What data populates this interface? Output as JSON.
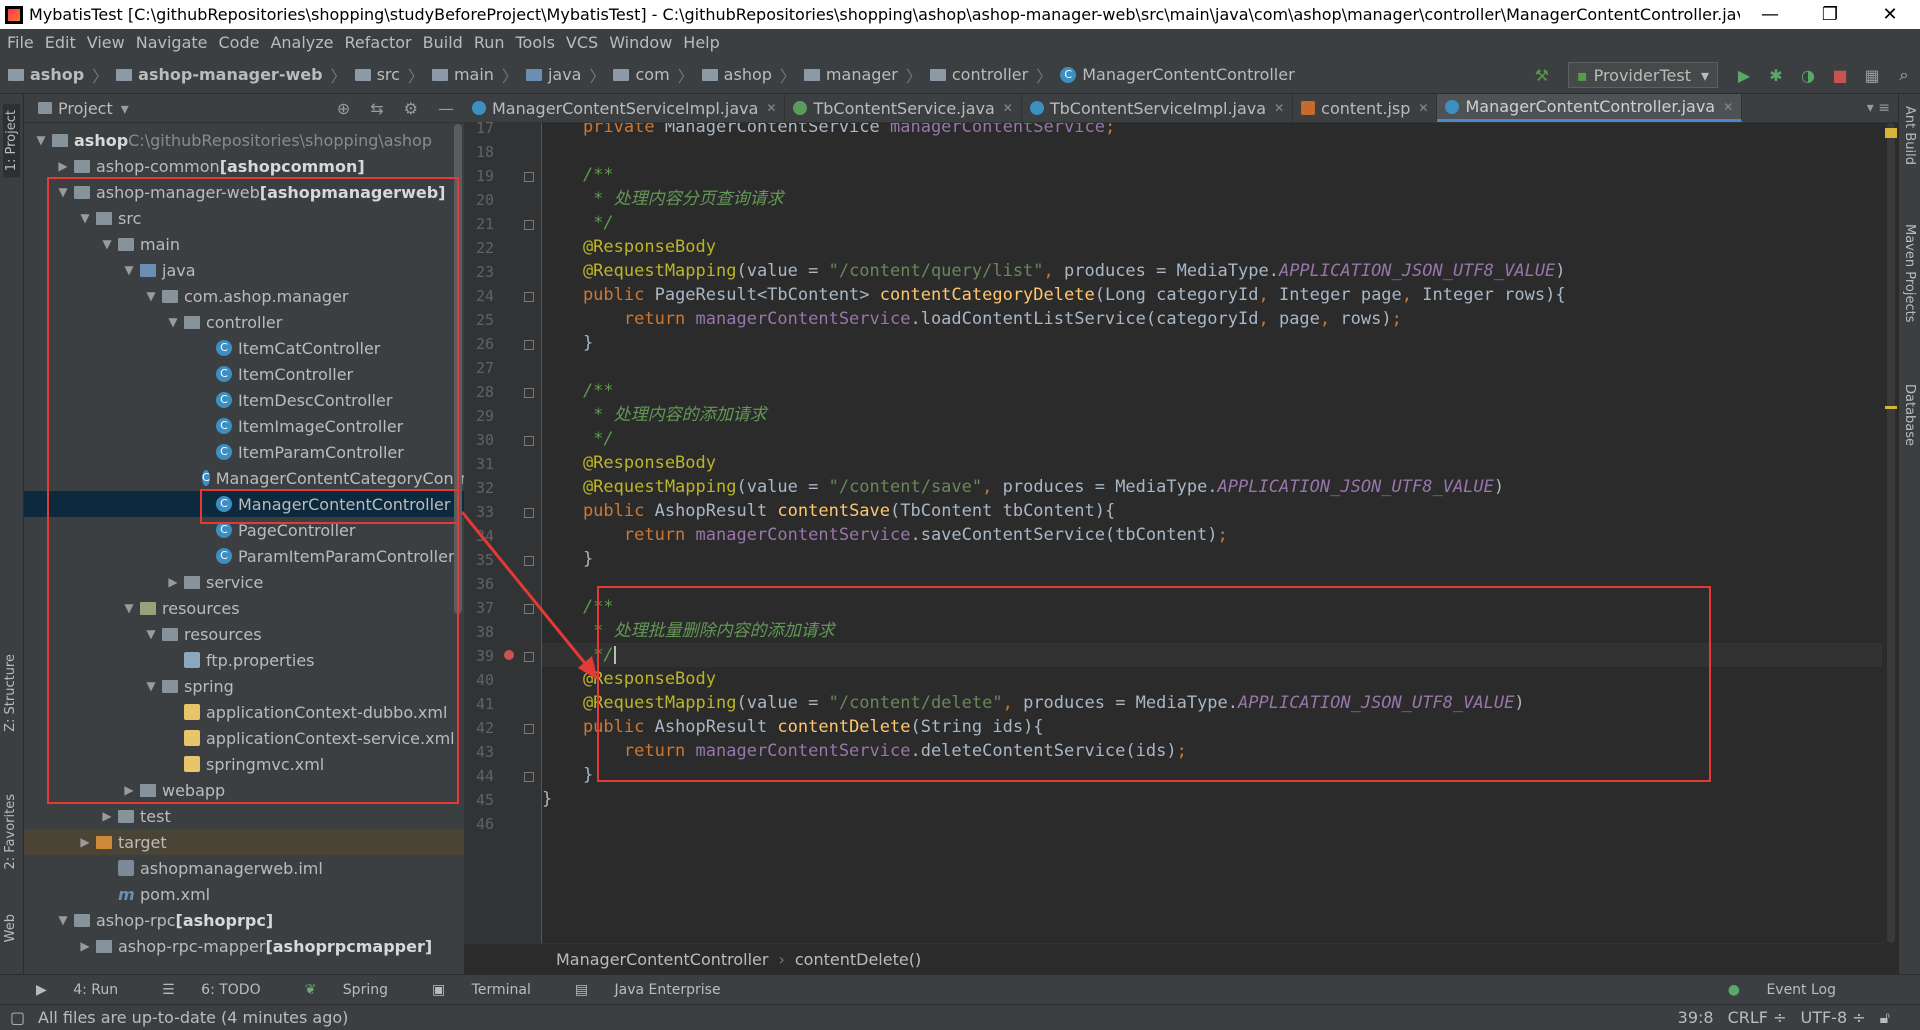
{
  "window": {
    "title": "MybatisTest [C:\\githubRepositories\\shopping\\studyBeforeProject\\MybatisTest] - C:\\githubRepositories\\shopping\\ashop\\ashop-manager-web\\src\\main\\java\\com\\ashop\\manager\\controller\\ManagerContentController.java [ashopmana...",
    "minimize": "—",
    "restore": "❐",
    "close": "✕"
  },
  "menu": [
    "File",
    "Edit",
    "View",
    "Navigate",
    "Code",
    "Analyze",
    "Refactor",
    "Build",
    "Run",
    "Tools",
    "VCS",
    "Window",
    "Help"
  ],
  "breadcrumbs": [
    "ashop",
    "ashop-manager-web",
    "src",
    "main",
    "java",
    "com",
    "ashop",
    "manager",
    "controller",
    "ManagerContentController"
  ],
  "run_config": "ProviderTest",
  "left_tabs": {
    "project": "1: Project",
    "structure": "Z: Structure",
    "favorites": "2: Favorites",
    "web": "Web"
  },
  "right_tabs": {
    "ant": "Ant Build",
    "maven": "Maven Projects",
    "database": "Database"
  },
  "project_panel": {
    "title": "Project",
    "dropdown": "▾"
  },
  "tree": [
    {
      "label": "ashop",
      "extra": "C:\\githubRepositories\\shopping\\ashop",
      "arrow": "▼",
      "icon": "folder-module"
    },
    {
      "label": "ashop-common",
      "extra": "[ashopcommon]",
      "arrow": "▶",
      "icon": "folder-module"
    },
    {
      "label": "ashop-manager-web",
      "extra": "[ashopmanagerweb]",
      "arrow": "▼",
      "icon": "folder-module"
    },
    {
      "label": "src",
      "extra": "",
      "arrow": "▼",
      "icon": "folder"
    },
    {
      "label": "main",
      "extra": "",
      "arrow": "▼",
      "icon": "folder"
    },
    {
      "label": "java",
      "extra": "",
      "arrow": "▼",
      "icon": "folder-source"
    },
    {
      "label": "com.ashop.manager",
      "extra": "",
      "arrow": "▼",
      "icon": "package"
    },
    {
      "label": "controller",
      "extra": "",
      "arrow": "▼",
      "icon": "package"
    },
    {
      "label": "ItemCatController",
      "extra": "",
      "arrow": "",
      "icon": "class"
    },
    {
      "label": "ItemController",
      "extra": "",
      "arrow": "",
      "icon": "class"
    },
    {
      "label": "ItemDescController",
      "extra": "",
      "arrow": "",
      "icon": "class"
    },
    {
      "label": "ItemImageController",
      "extra": "",
      "arrow": "",
      "icon": "class"
    },
    {
      "label": "ItemParamController",
      "extra": "",
      "arrow": "",
      "icon": "class"
    },
    {
      "label": "ManagerContentCategoryContr",
      "extra": "",
      "arrow": "",
      "icon": "class"
    },
    {
      "label": "ManagerContentController",
      "extra": "",
      "arrow": "",
      "icon": "class"
    },
    {
      "label": "PageController",
      "extra": "",
      "arrow": "",
      "icon": "class"
    },
    {
      "label": "ParamItemParamController",
      "extra": "",
      "arrow": "",
      "icon": "class"
    },
    {
      "label": "service",
      "extra": "",
      "arrow": "▶",
      "icon": "package"
    },
    {
      "label": "resources",
      "extra": "",
      "arrow": "▼",
      "icon": "folder-res"
    },
    {
      "label": "resources",
      "extra": "",
      "arrow": "▼",
      "icon": "package"
    },
    {
      "label": "ftp.properties",
      "extra": "",
      "arrow": "",
      "icon": "props"
    },
    {
      "label": "spring",
      "extra": "",
      "arrow": "▼",
      "icon": "package"
    },
    {
      "label": "applicationContext-dubbo.xml",
      "extra": "",
      "arrow": "",
      "icon": "xml"
    },
    {
      "label": "applicationContext-service.xml",
      "extra": "",
      "arrow": "",
      "icon": "xml"
    },
    {
      "label": "springmvc.xml",
      "extra": "",
      "arrow": "",
      "icon": "xml"
    },
    {
      "label": "webapp",
      "extra": "",
      "arrow": "▶",
      "icon": "folder"
    },
    {
      "label": "test",
      "extra": "",
      "arrow": "▶",
      "icon": "folder"
    },
    {
      "label": "target",
      "extra": "",
      "arrow": "▶",
      "icon": "folder-target"
    },
    {
      "label": "ashopmanagerweb.iml",
      "extra": "",
      "arrow": "",
      "icon": "iml"
    },
    {
      "label": "pom.xml",
      "extra": "",
      "arrow": "",
      "icon": "maven"
    },
    {
      "label": "ashop-rpc",
      "extra": "[ashoprpc]",
      "arrow": "▼",
      "icon": "folder-module"
    },
    {
      "label": "ashop-rpc-mapper",
      "extra": "[ashoprpcmapper]",
      "arrow": "▶",
      "icon": "folder-module"
    }
  ],
  "editor_tabs": [
    {
      "label": "ManagerContentServiceImpl.java",
      "icon": "class"
    },
    {
      "label": "TbContentService.java",
      "icon": "interface"
    },
    {
      "label": "TbContentServiceImpl.java",
      "icon": "class"
    },
    {
      "label": "content.jsp",
      "icon": "jsp"
    },
    {
      "label": "ManagerContentController.java",
      "icon": "class"
    }
  ],
  "tabs_overflow": "▾ ≡",
  "line_numbers": [
    "17",
    "18",
    "19",
    "20",
    "21",
    "22",
    "23",
    "24",
    "25",
    "26",
    "27",
    "28",
    "29",
    "30",
    "31",
    "32",
    "33",
    "34",
    "35",
    "36",
    "37",
    "38",
    "39",
    "40",
    "41",
    "42",
    "43",
    "44",
    "45",
    "46"
  ],
  "code_lines": [
    [
      [
        "kw",
        "    private "
      ],
      [
        "tx",
        "ManagerContentService "
      ],
      [
        "fld",
        "managerContentService"
      ],
      [
        "kw",
        ";"
      ]
    ],
    [],
    [
      [
        "cm",
        "    /**"
      ]
    ],
    [
      [
        "cm",
        "     * 处理内容分页查询请求"
      ]
    ],
    [
      [
        "cm",
        "     */"
      ]
    ],
    [
      [
        "an",
        "    @ResponseBody"
      ]
    ],
    [
      [
        "an",
        "    @RequestMapping"
      ],
      [
        "tx",
        "(value = "
      ],
      [
        "st",
        "\"/content/query/list\""
      ],
      [
        "kw",
        ", "
      ],
      [
        "tx",
        "produces = MediaType."
      ],
      [
        "cst",
        "APPLICATION_JSON_UTF8_VALUE"
      ],
      [
        "tx",
        ")"
      ]
    ],
    [
      [
        "kw",
        "    public "
      ],
      [
        "tx",
        "PageResult<TbContent> "
      ],
      [
        "fn",
        "contentCategoryDelete"
      ],
      [
        "tx",
        "(Long categoryId"
      ],
      [
        "kw",
        ", "
      ],
      [
        "tx",
        "Integer page"
      ],
      [
        "kw",
        ", "
      ],
      [
        "tx",
        "Integer rows){"
      ]
    ],
    [
      [
        "kw",
        "        return "
      ],
      [
        "fld",
        "managerContentService"
      ],
      [
        "tx",
        ".loadContentListService(categoryId"
      ],
      [
        "kw",
        ", "
      ],
      [
        "tx",
        "page"
      ],
      [
        "kw",
        ", "
      ],
      [
        "tx",
        "rows)"
      ],
      [
        "kw",
        ";"
      ]
    ],
    [
      [
        "tx",
        "    }"
      ]
    ],
    [],
    [
      [
        "cm",
        "    /**"
      ]
    ],
    [
      [
        "cm",
        "     * 处理内容的添加请求"
      ]
    ],
    [
      [
        "cm",
        "     */"
      ]
    ],
    [
      [
        "an",
        "    @ResponseBody"
      ]
    ],
    [
      [
        "an",
        "    @RequestMapping"
      ],
      [
        "tx",
        "(value = "
      ],
      [
        "st",
        "\"/content/save\""
      ],
      [
        "kw",
        ", "
      ],
      [
        "tx",
        "produces = MediaType."
      ],
      [
        "cst",
        "APPLICATION_JSON_UTF8_VALUE"
      ],
      [
        "tx",
        ")"
      ]
    ],
    [
      [
        "kw",
        "    public "
      ],
      [
        "tx",
        "AshopResult "
      ],
      [
        "fn",
        "contentSave"
      ],
      [
        "tx",
        "(TbContent tbContent){"
      ]
    ],
    [
      [
        "kw",
        "        return "
      ],
      [
        "fld",
        "managerContentService"
      ],
      [
        "tx",
        ".saveContentService(tbContent)"
      ],
      [
        "kw",
        ";"
      ]
    ],
    [
      [
        "tx",
        "    }"
      ]
    ],
    [],
    [
      [
        "cm",
        "    /**"
      ]
    ],
    [
      [
        "cm",
        "     * 处理批量删除内容的添加请求"
      ]
    ],
    [
      [
        "cm",
        "     */"
      ]
    ],
    [
      [
        "an",
        "    @ResponseBody"
      ]
    ],
    [
      [
        "an",
        "    @RequestMapping"
      ],
      [
        "tx",
        "(value = "
      ],
      [
        "st",
        "\"/content/delete\""
      ],
      [
        "kw",
        ", "
      ],
      [
        "tx",
        "produces = MediaType."
      ],
      [
        "cst",
        "APPLICATION_JSON_UTF8_VALUE"
      ],
      [
        "tx",
        ")"
      ]
    ],
    [
      [
        "kw",
        "    public "
      ],
      [
        "tx",
        "AshopResult "
      ],
      [
        "fn",
        "contentDelete"
      ],
      [
        "tx",
        "(String ids){"
      ]
    ],
    [
      [
        "kw",
        "        return "
      ],
      [
        "fld",
        "managerContentService"
      ],
      [
        "tx",
        ".deleteContentService(ids)"
      ],
      [
        "kw",
        ";"
      ]
    ],
    [
      [
        "tx",
        "    }"
      ]
    ],
    [
      [
        "tx",
        "}"
      ]
    ],
    []
  ],
  "editor_breadcrumb": {
    "class": "ManagerContentController",
    "method": "contentDelete()",
    "sep": "›"
  },
  "tool_windows": [
    "4: Run",
    "6: TODO",
    "Spring",
    "Terminal",
    "Java Enterprise"
  ],
  "event_log": "Event Log",
  "status": {
    "message": "All files are up-to-date (4 minutes ago)",
    "position": "39:8",
    "line_sep": "CRLF ÷",
    "encoding": "UTF-8 ÷"
  }
}
